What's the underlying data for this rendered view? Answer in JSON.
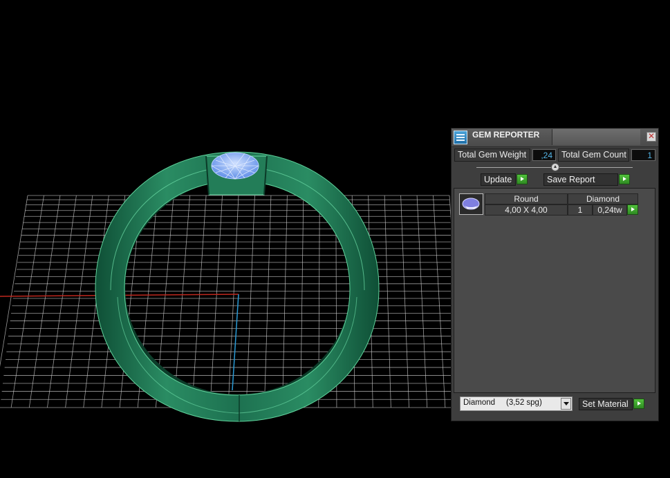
{
  "viewport": {
    "background": "#000000",
    "grid_color": "#cfcfcf",
    "axis_x_color": "#c0281e",
    "axis_y_color": "#2a9bd6",
    "ring_color": "#1f7a55",
    "gem_color": "#8fb8ff"
  },
  "panel": {
    "title": "GEM REPORTER",
    "close_glyph": "✕",
    "total_gem_weight_label": "Total Gem Weight",
    "total_gem_weight_value": ",24",
    "total_gem_count_label": "Total Gem Count",
    "total_gem_count_value": "1",
    "update_label": "Update",
    "save_report_label": "Save Report",
    "gem_list": {
      "columns": [
        "Round",
        "Diamond"
      ],
      "rows": [
        {
          "cut": "Round",
          "size": "4,00 X 4,00",
          "material": "Diamond",
          "count": "1",
          "weight": "0,24tw"
        }
      ]
    },
    "material_select": {
      "value": "Diamond     (3,52 spg)"
    },
    "set_material_label": "Set Material"
  },
  "icons": {
    "title_icon": "gem-reporter-icon",
    "gem_thumbnail": "gem-thumbnail-icon",
    "play": "play-arrow-icon",
    "close": "close-icon",
    "slider": "slider-knob-icon",
    "dropdown": "chevron-down-icon"
  }
}
